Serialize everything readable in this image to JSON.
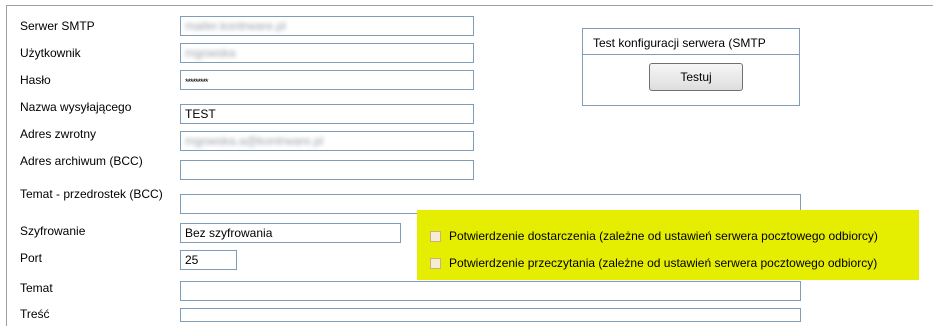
{
  "fields": {
    "smtp_server": {
      "label": "Serwer SMTP",
      "value": "mailer.kontrware.pl"
    },
    "user": {
      "label": "Użytkownik",
      "value": "mgowska"
    },
    "password": {
      "label": "Hasło",
      "value": "*********"
    },
    "sender_name": {
      "label": "Nazwa wysyłającego",
      "value": "TEST"
    },
    "reply_address": {
      "label": "Adres zwrotny",
      "value": "mgowska.a@kontrware.pl"
    },
    "archive_address": {
      "label": "Adres archiwum (BCC)",
      "value": ""
    },
    "subject_prefix": {
      "label": "Temat - przedrostek (BCC)",
      "value": ""
    },
    "encryption": {
      "label": "Szyfrowanie",
      "value": "Bez szyfrowania"
    },
    "port": {
      "label": "Port",
      "value": "25"
    },
    "subject": {
      "label": "Temat",
      "value": ""
    },
    "body": {
      "label": "Treść",
      "value": ""
    }
  },
  "server_test": {
    "title": "Test konfiguracji serwera (SMTP",
    "button_label": "Testuj"
  },
  "options": {
    "delivery_receipt": {
      "label": "Potwierdzenie dostarczenia (zależne od ustawień serwera pocztowego odbiorcy)",
      "checked": false
    },
    "read_receipt": {
      "label": "Potwierdzenie przeczytania (zależne od ustawień serwera pocztowego odbiorcy)",
      "checked": false
    }
  },
  "colors": {
    "highlight": "#e5ee00",
    "field_border": "#7f9db9"
  }
}
